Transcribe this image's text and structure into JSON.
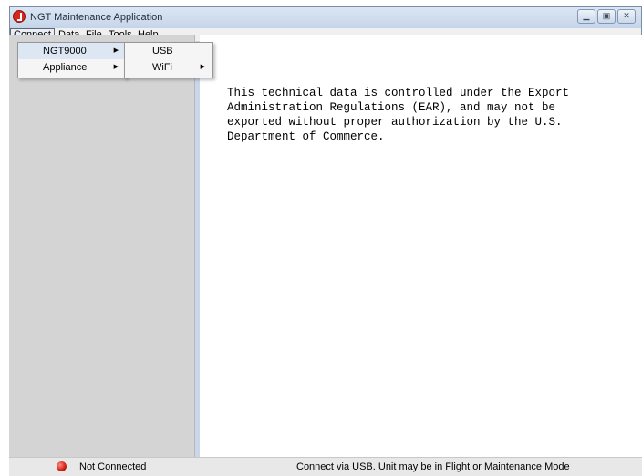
{
  "window": {
    "title": "NGT Maintenance Application",
    "buttons": [
      "minimize-icon",
      "maximize-icon",
      "close-icon"
    ]
  },
  "menubar": {
    "items": [
      "Connect",
      "Data",
      "File",
      "Tools",
      "Help"
    ],
    "active": "Connect"
  },
  "connect_menu": {
    "items": [
      {
        "label": "NGT9000",
        "has_submenu": true
      },
      {
        "label": "Appliance",
        "has_submenu": true
      }
    ]
  },
  "connect_submenu": {
    "items": [
      {
        "label": "USB",
        "has_submenu": false
      },
      {
        "label": "WiFi",
        "has_submenu": true
      }
    ]
  },
  "content": {
    "notice": "This technical data is controlled under the Export\nAdministration Regulations (EAR), and may not be\nexported without proper authorization by the U.S.\nDepartment of Commerce."
  },
  "statusbar": {
    "connection": "Not Connected",
    "connection_color": "#d01c10",
    "message": "Connect via USB. Unit may be in Flight or Maintenance Mode"
  },
  "colors": {
    "titlebar": "#c5d5e9",
    "panel": "#d4d4d4",
    "menu_highlight": "#dde7f4"
  }
}
